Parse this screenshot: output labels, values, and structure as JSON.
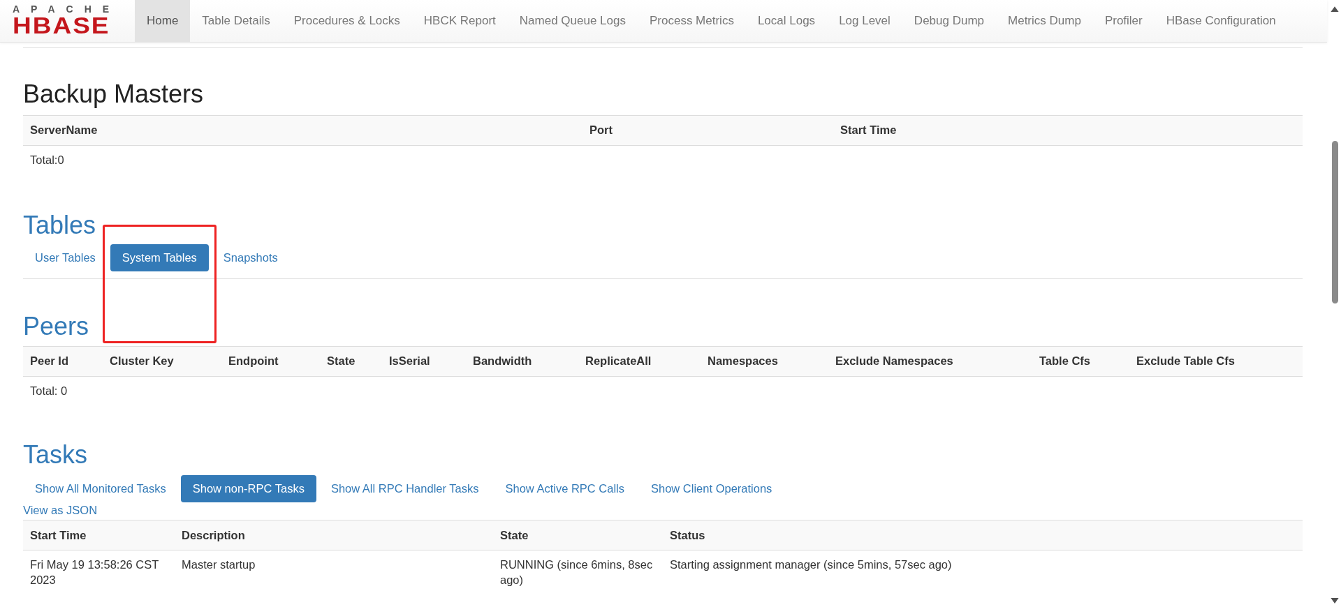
{
  "logo": {
    "top": "APACHE",
    "main": "HBASE"
  },
  "nav": [
    {
      "label": "Home",
      "selected": true
    },
    {
      "label": "Table Details",
      "selected": false
    },
    {
      "label": "Procedures & Locks",
      "selected": false
    },
    {
      "label": "HBCK Report",
      "selected": false
    },
    {
      "label": "Named Queue Logs",
      "selected": false
    },
    {
      "label": "Process Metrics",
      "selected": false
    },
    {
      "label": "Local Logs",
      "selected": false
    },
    {
      "label": "Log Level",
      "selected": false
    },
    {
      "label": "Debug Dump",
      "selected": false
    },
    {
      "label": "Metrics Dump",
      "selected": false
    },
    {
      "label": "Profiler",
      "selected": false
    },
    {
      "label": "HBase Configuration",
      "selected": false
    }
  ],
  "backup_masters": {
    "title": "Backup Masters",
    "columns": [
      "ServerName",
      "Port",
      "Start Time"
    ],
    "total": "Total:0"
  },
  "tables": {
    "title": "Tables",
    "tabs": [
      {
        "label": "User Tables",
        "selected": false
      },
      {
        "label": "System Tables",
        "selected": true
      },
      {
        "label": "Snapshots",
        "selected": false
      }
    ]
  },
  "peers": {
    "title": "Peers",
    "columns": [
      "Peer Id",
      "Cluster Key",
      "Endpoint",
      "State",
      "IsSerial",
      "Bandwidth",
      "ReplicateAll",
      "Namespaces",
      "Exclude Namespaces",
      "Table Cfs",
      "Exclude Table Cfs"
    ],
    "total": "Total: 0"
  },
  "tasks": {
    "title": "Tasks",
    "tabs": [
      {
        "label": "Show All Monitored Tasks",
        "selected": false
      },
      {
        "label": "Show non-RPC Tasks",
        "selected": true
      },
      {
        "label": "Show All RPC Handler Tasks",
        "selected": false
      },
      {
        "label": "Show Active RPC Calls",
        "selected": false
      },
      {
        "label": "Show Client Operations",
        "selected": false
      }
    ],
    "json_link": "View as JSON",
    "columns": [
      "Start Time",
      "Description",
      "State",
      "Status"
    ],
    "rows": [
      [
        "Fri May 19 13:58:26 CST 2023",
        "Master startup",
        "RUNNING (since 6mins, 8sec ago)",
        "Starting assignment manager (since 5mins, 57sec ago)"
      ]
    ]
  }
}
